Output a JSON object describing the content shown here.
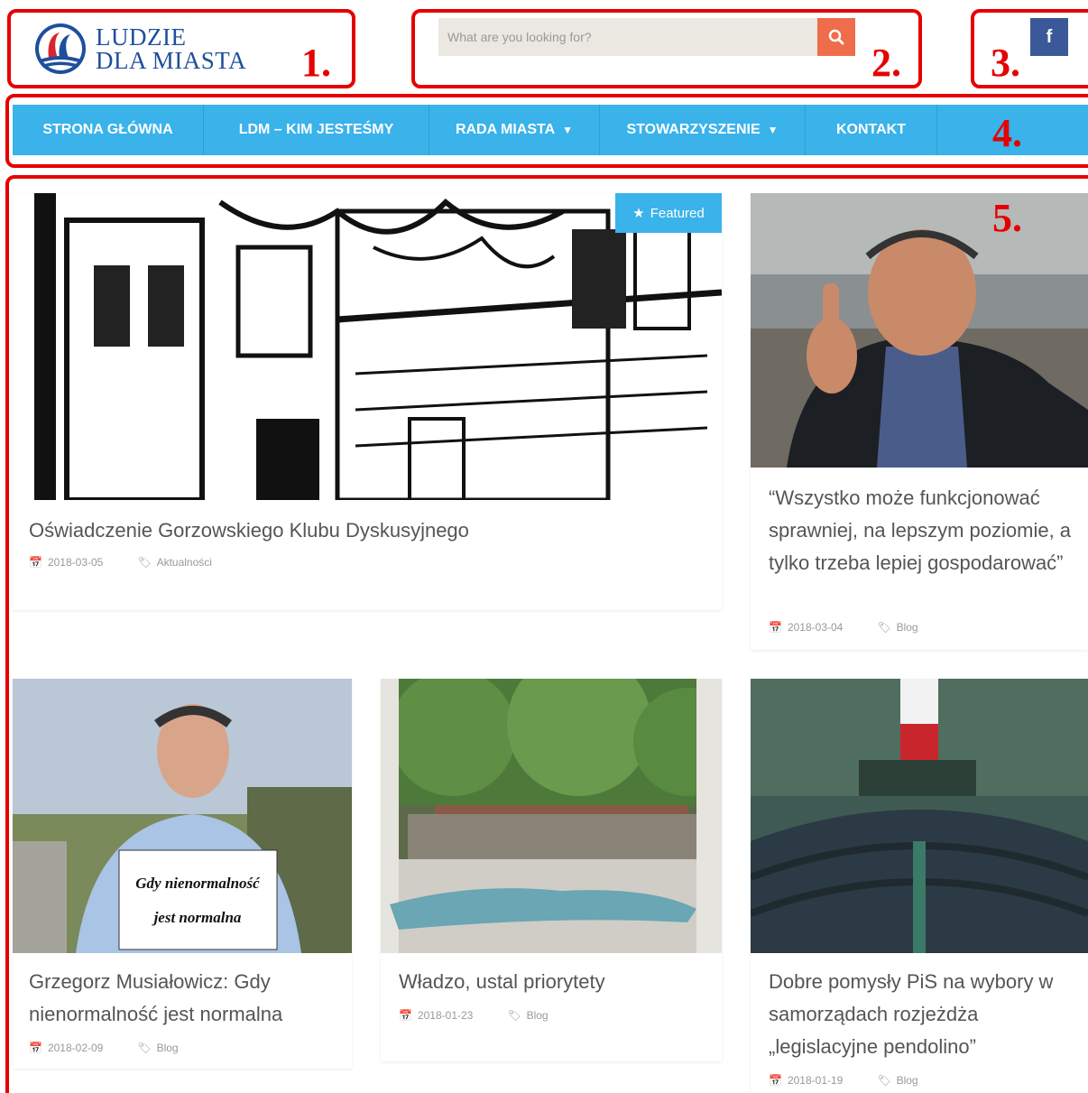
{
  "header": {
    "logo_line1": "LUDZIE",
    "logo_line2": "DLA MIASTA",
    "search_placeholder": "What are you looking for?",
    "facebook_label": "f"
  },
  "annotations": [
    "1.",
    "2.",
    "3.",
    "4.",
    "5."
  ],
  "nav": {
    "items": [
      {
        "label": "STRONA GŁÓWNA"
      },
      {
        "label": "LDM – KIM JESTEŚMY"
      },
      {
        "label": "RADA MIASTA",
        "caret": "▼"
      },
      {
        "label": "STOWARZYSZENIE",
        "caret": "▼"
      },
      {
        "label": "KONTAKT"
      }
    ]
  },
  "posts": [
    {
      "title": "Oświadczenie Gorzowskiego Klubu Dyskusyjnego",
      "date": "2018-03-05",
      "category": "Aktualności",
      "badge": "Featured"
    },
    {
      "title": "“Wszystko może funkcjonować sprawniej, na lepszym poziomie, a tylko trzeba lepiej gospodarować”",
      "date": "2018-03-04",
      "category": "Blog"
    },
    {
      "title": "Grzegorz Musiałowicz: Gdy nienormalność jest normalna",
      "date": "2018-02-09",
      "category": "Blog",
      "sign_line1": "Gdy nienormalność",
      "sign_line2": "jest normalna"
    },
    {
      "title": "Władzo, ustal priorytety",
      "date": "2018-01-23",
      "category": "Blog"
    },
    {
      "title": "Dobre pomysły PiS na wybory w samorządach rozjeżdża „legislacyjne pendolino”",
      "date": "2018-01-19",
      "category": "Blog"
    }
  ],
  "colors": {
    "accent": "#3ab2ea",
    "search_button": "#ef6d4a",
    "facebook": "#3b5998",
    "annotation": "#e60000"
  },
  "icons": [
    "search-icon",
    "facebook-icon",
    "star-icon",
    "calendar-icon",
    "tag-icon",
    "chevron-down-icon"
  ]
}
